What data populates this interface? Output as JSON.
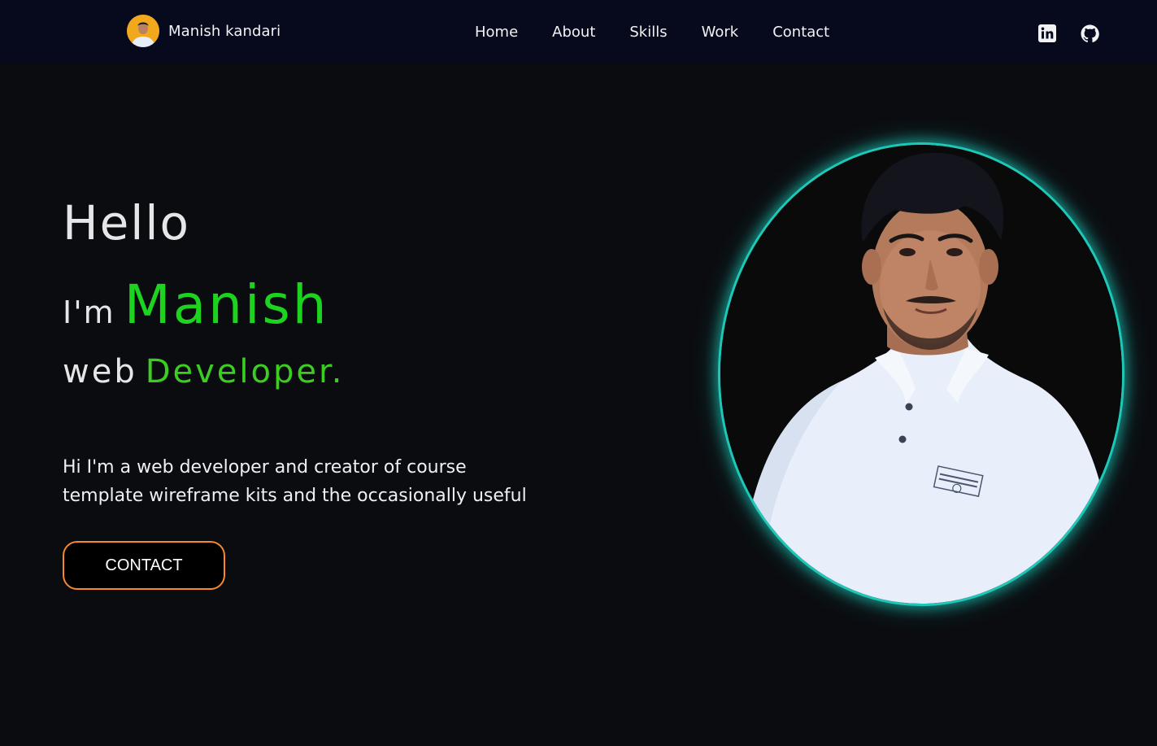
{
  "navbar": {
    "brand_name": "Manish kandari",
    "links": [
      {
        "label": "Home"
      },
      {
        "label": "About"
      },
      {
        "label": "Skills"
      },
      {
        "label": "Work"
      },
      {
        "label": "Contact"
      }
    ],
    "socials": [
      {
        "icon": "linkedin-icon"
      },
      {
        "icon": "github-icon"
      }
    ]
  },
  "hero": {
    "greeting": "Hello",
    "im_prefix": "I'm",
    "name": "Manish",
    "role_prefix": "web",
    "role_highlight": "Developer.",
    "intro_line1": "Hi I'm a web developer and creator of course",
    "intro_line2": "template wireframe kits and the occasionally useful",
    "cta_label": "CONTACT"
  },
  "colors": {
    "page_bg": "#0b0c10",
    "navbar_bg": "#060a1c",
    "name_green": "#1cd41e",
    "role_green": "#3ccc22",
    "cta_border": "#f5892c",
    "portrait_glow": "#1ec8b8"
  }
}
